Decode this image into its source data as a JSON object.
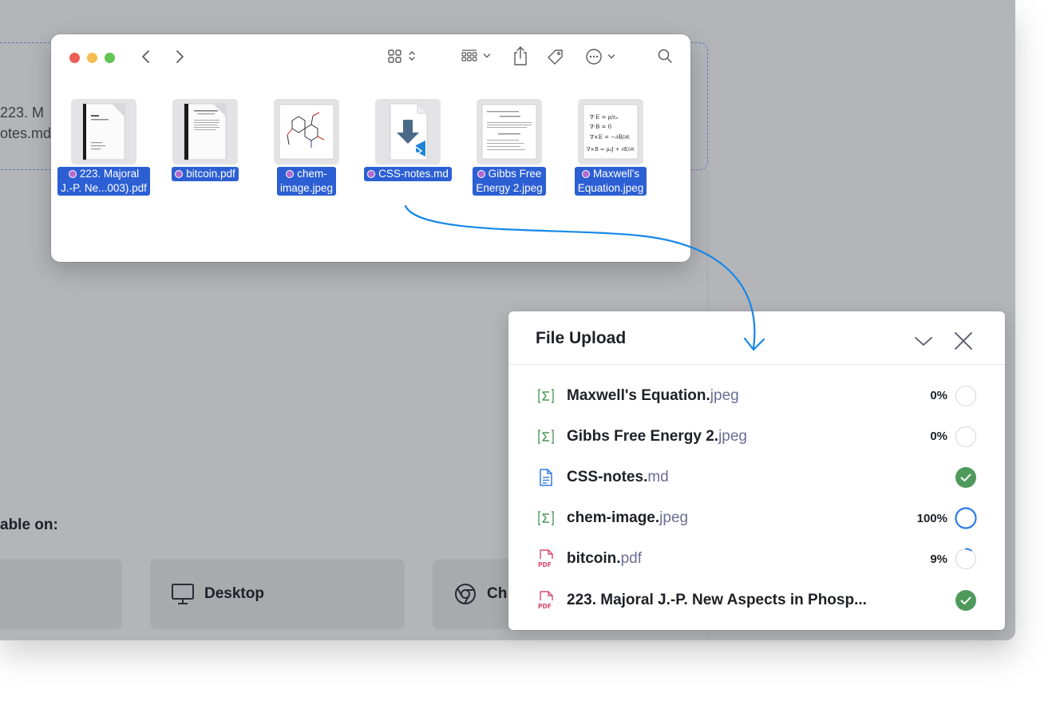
{
  "background": {
    "file_lines": [
      "223. M",
      "otes.md"
    ],
    "available_label": "able on:",
    "platform_cards": [
      {
        "label": "",
        "icon": "none"
      },
      {
        "label": "Desktop",
        "icon": "monitor-icon"
      },
      {
        "label": "Ch",
        "icon": "chrome-icon"
      }
    ]
  },
  "finder": {
    "files": [
      {
        "label_line1": "223. Majoral",
        "label_line2": "J.-P. Ne...003).pdf",
        "tag_color": "#b36ad0",
        "icon": "pdf-document-thumbnail"
      },
      {
        "label_line1": "bitcoin.pdf",
        "label_line2": "",
        "tag_color": "#b36ad0",
        "icon": "pdf-document-thumbnail"
      },
      {
        "label_line1": "chem-",
        "label_line2": "image.jpeg",
        "tag_color": "#b36ad0",
        "icon": "chemical-structure-thumbnail"
      },
      {
        "label_line1": "CSS-notes.md",
        "label_line2": "",
        "tag_color": "#b36ad0",
        "icon": "vscode-markdown-file-icon"
      },
      {
        "label_line1": "Gibbs Free",
        "label_line2": "Energy 2.jpeg",
        "tag_color": "#b36ad0",
        "icon": "text-image-thumbnail"
      },
      {
        "label_line1": "Maxwell's",
        "label_line2": "Equation.jpeg",
        "tag_color": "#b36ad0",
        "icon": "equation-image-thumbnail"
      }
    ]
  },
  "upload": {
    "title": "File Upload",
    "items": [
      {
        "base": "Maxwell's Equation.",
        "ext": "jpeg",
        "percent": "0%",
        "progress": 0,
        "status": "pending",
        "icon": "formula-icon"
      },
      {
        "base": "Gibbs Free Energy 2.",
        "ext": "jpeg",
        "percent": "0%",
        "progress": 0,
        "status": "pending",
        "icon": "formula-icon"
      },
      {
        "base": "CSS-notes.",
        "ext": "md",
        "percent": "",
        "progress": 1,
        "status": "done",
        "icon": "document-icon"
      },
      {
        "base": "chem-image.",
        "ext": "jpeg",
        "percent": "100%",
        "progress": 1,
        "status": "uploading",
        "icon": "formula-icon"
      },
      {
        "base": "bitcoin.",
        "ext": "pdf",
        "percent": "9%",
        "progress": 0.09,
        "status": "uploading",
        "icon": "pdf-icon"
      },
      {
        "base": "223. Majoral J.-P. New Aspects in Phosp...",
        "ext": "",
        "percent": "",
        "progress": 1,
        "status": "done",
        "icon": "pdf-icon"
      }
    ]
  },
  "colors": {
    "selection": "#2c5fd4",
    "success": "#4f9a5b",
    "progress": "#2f7ae5",
    "arrow": "#1687e8",
    "extension": "#6a6e93"
  }
}
